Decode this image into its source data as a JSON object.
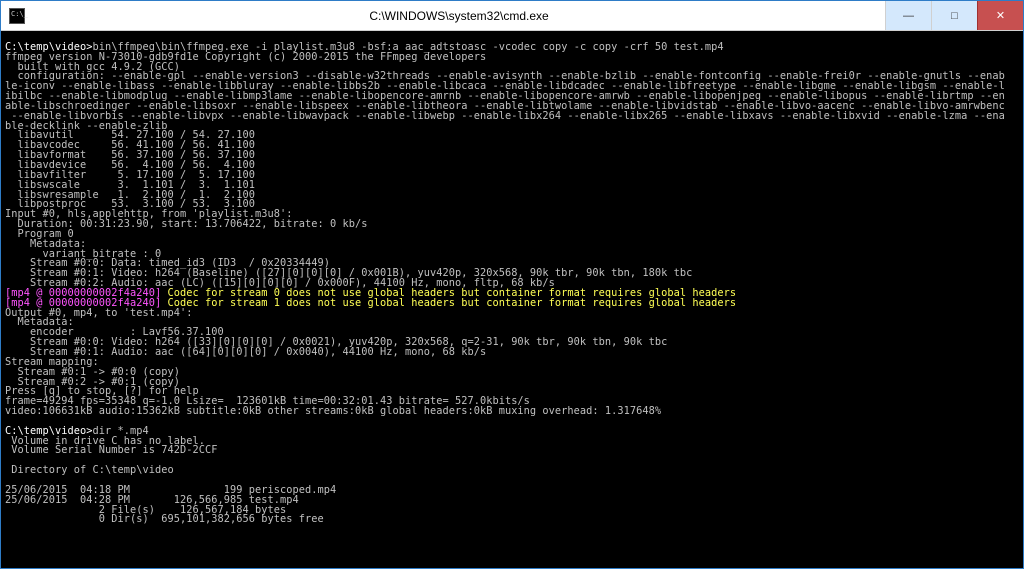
{
  "window": {
    "title": "C:\\WINDOWS\\system32\\cmd.exe"
  },
  "titlebar": {
    "min_glyph": "—",
    "max_glyph": "□",
    "close_glyph": "✕"
  },
  "terminal": {
    "prompt1": "C:\\temp\\video>",
    "cmd1": "bin\\ffmpeg\\bin\\ffmpeg.exe -i playlist.m3u8 -bsf:a aac_adtstoasc -vcodec copy -c copy -crf 50 test.mp4",
    "line_version": "ffmpeg version N-73010-gdb9fd1e Copyright (c) 2000-2015 the FFmpeg developers",
    "line_built": "  built with gcc 4.9.2 (GCC)",
    "line_cfg1": "  configuration: --enable-gpl --enable-version3 --disable-w32threads --enable-avisynth --enable-bzlib --enable-fontconfig --enable-frei0r --enable-gnutls --enab",
    "line_cfg2": "le-iconv --enable-libass --enable-libbluray --enable-libbs2b --enable-libcaca --enable-libdcadec --enable-libfreetype --enable-libgme --enable-libgsm --enable-l",
    "line_cfg3": "ibilbc --enable-libmodplug --enable-libmp3lame --enable-libopencore-amrnb --enable-libopencore-amrwb --enable-libopenjpeg --enable-libopus --enable-librtmp --en",
    "line_cfg4": "able-libschroedinger --enable-libsoxr --enable-libspeex --enable-libtheora --enable-libtwolame --enable-libvidstab --enable-libvo-aacenc --enable-libvo-amrwbenc",
    "line_cfg5": " --enable-libvorbis --enable-libvpx --enable-libwavpack --enable-libwebp --enable-libx264 --enable-libx265 --enable-libxavs --enable-libxvid --enable-lzma --ena",
    "line_cfg6": "ble-decklink --enable-zlib",
    "line_lib1": "  libavutil      54. 27.100 / 54. 27.100",
    "line_lib2": "  libavcodec     56. 41.100 / 56. 41.100",
    "line_lib3": "  libavformat    56. 37.100 / 56. 37.100",
    "line_lib4": "  libavdevice    56.  4.100 / 56.  4.100",
    "line_lib5": "  libavfilter     5. 17.100 /  5. 17.100",
    "line_lib6": "  libswscale      3.  1.101 /  3.  1.101",
    "line_lib7": "  libswresample   1.  2.100 /  1.  2.100",
    "line_lib8": "  libpostproc    53.  3.100 / 53.  3.100",
    "line_input0": "Input #0, hls,applehttp, from 'playlist.m3u8':",
    "line_duration": "  Duration: 00:31:23.90, start: 13.706422, bitrate: 0 kb/s",
    "line_program": "  Program 0",
    "line_meta1": "    Metadata:",
    "line_variant": "      variant_bitrate : 0",
    "line_stream00": "    Stream #0:0: Data: timed_id3 (ID3  / 0x20334449)",
    "line_stream01": "    Stream #0:1: Video: h264 (Baseline) ([27][0][0][0] / 0x001B), yuv420p, 320x568, 90k tbr, 90k tbn, 180k tbc",
    "line_stream02": "    Stream #0:2: Audio: aac (LC) ([15][0][0][0] / 0x000F), 44100 Hz, mono, fltp, 68 kb/s",
    "warn_prefix1": "[mp4 @ 00000000002f4a240]",
    "warn_msg1": " Codec for stream 0 does not use global headers but container format requires global headers",
    "warn_prefix2": "[mp4 @ 00000000002f4a240]",
    "warn_msg2": " Codec for stream 1 does not use global headers but container format requires global headers",
    "line_output0": "Output #0, mp4, to 'test.mp4':",
    "line_meta2": "  Metadata:",
    "line_encoder": "    encoder         : Lavf56.37.100",
    "line_ostream00": "    Stream #0:0: Video: h264 ([33][0][0][0] / 0x0021), yuv420p, 320x568, q=2-31, 90k tbr, 90k tbn, 90k tbc",
    "line_ostream01": "    Stream #0:1: Audio: aac ([64][0][0][0] / 0x0040), 44100 Hz, mono, 68 kb/s",
    "line_smap": "Stream mapping:",
    "line_smap1": "  Stream #0:1 -> #0:0 (copy)",
    "line_smap2": "  Stream #0:2 -> #0:1 (copy)",
    "line_press": "Press [q] to stop, [?] for help",
    "line_frame": "frame=49294 fps=35348 q=-1.0 Lsize=  123601kB time=00:32:01.43 bitrate= 527.0kbits/s",
    "line_video": "video:106631kB audio:15362kB subtitle:0kB other streams:0kB global headers:0kB muxing overhead: 1.317648%",
    "prompt2": "C:\\temp\\video>",
    "cmd2": "dir *.mp4",
    "line_vol": " Volume in drive C has no label.",
    "line_serial": " Volume Serial Number is 742D-2CCF",
    "line_dirof": " Directory of C:\\temp\\video",
    "line_file1": "25/06/2015  04:18 PM               199 periscoped.mp4",
    "line_file2": "25/06/2015  04:28 PM       126,566,985 test.mp4",
    "line_filecount": "               2 File(s)    126,567,184 bytes",
    "line_dircount": "               0 Dir(s)  695,101,382,656 bytes free"
  }
}
